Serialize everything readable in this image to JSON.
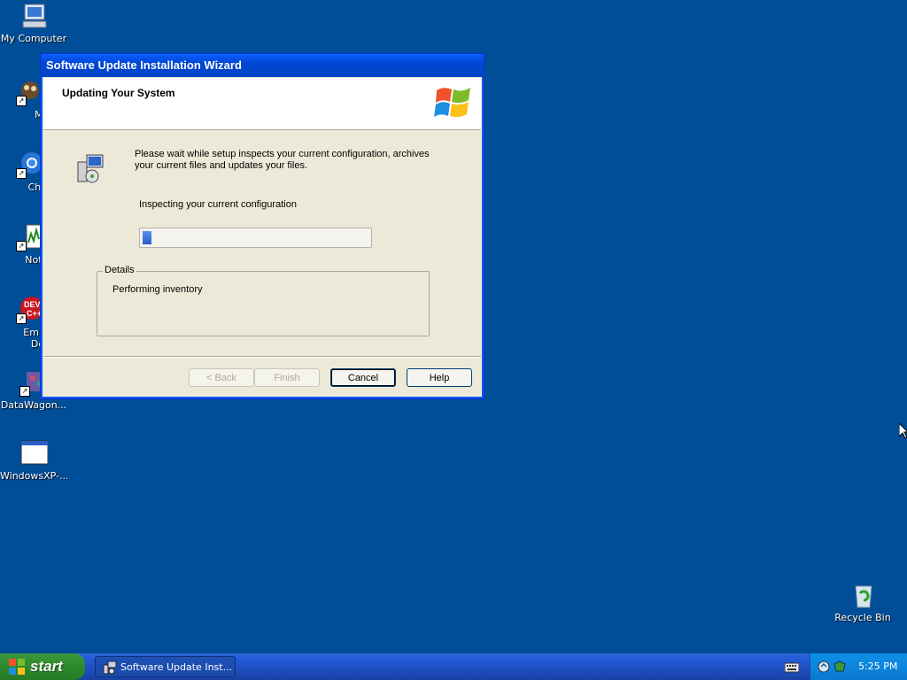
{
  "desktop": {
    "icons": [
      {
        "label": "My Computer",
        "icon": "my-computer-icon"
      },
      {
        "label": "MyPa",
        "icon": "mypaint-icon"
      },
      {
        "label": "Chrom",
        "icon": "chrome-icon"
      },
      {
        "label": "Notepa",
        "icon": "notepad-icon"
      },
      {
        "label": "Embarc",
        "label2": "Dev-C",
        "icon": "dev-cpp-icon"
      },
      {
        "label": "DataWagon...",
        "icon": "datawagon-icon"
      },
      {
        "label": "WindowsXP-...",
        "icon": "window-app-icon"
      },
      {
        "label": "Recycle Bin",
        "icon": "recycle-bin-icon"
      }
    ]
  },
  "window": {
    "title": "Software Update Installation Wizard",
    "header_title": "Updating Your System",
    "message": "Please wait while setup inspects your current configuration, archives your current files and updates your files.",
    "status": "Inspecting your current configuration",
    "progress_fraction": 0.03,
    "details_label": "Details",
    "details_text": "Performing inventory",
    "buttons": {
      "back": "< Back",
      "finish": "Finish",
      "cancel": "Cancel",
      "help": "Help"
    }
  },
  "taskbar": {
    "start_label": "start",
    "task_item": "Software Update Inst...",
    "clock": "5:25 PM"
  },
  "colors": {
    "desktop": "#004e98",
    "title_bar": "#0a5fff",
    "start_green": "#2c8a2c"
  }
}
